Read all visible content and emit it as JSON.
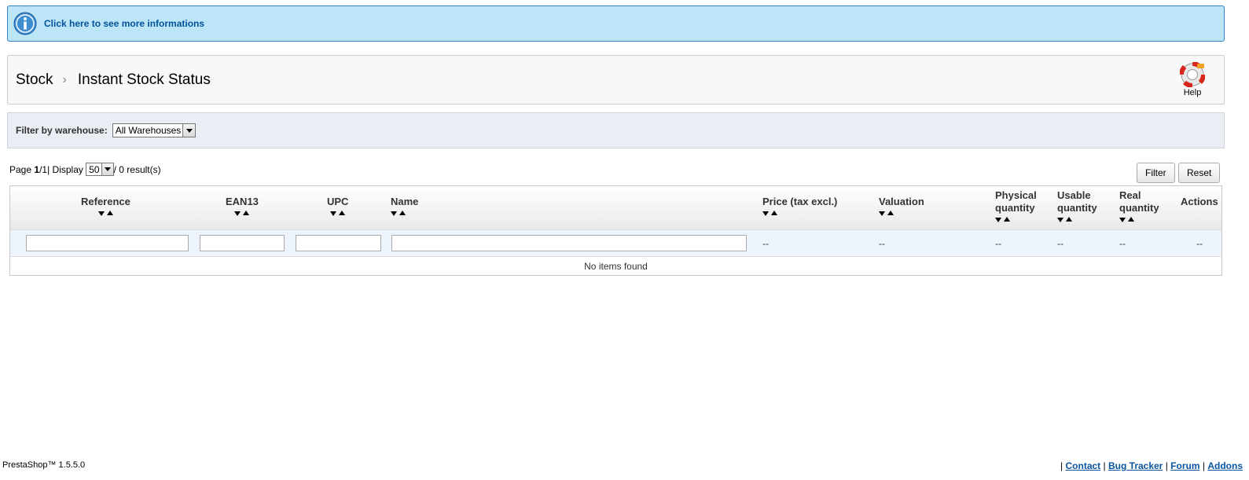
{
  "info_bar": {
    "link": "Click here to see more informations"
  },
  "toolbar": {
    "breadcrumb": {
      "parent": "Stock",
      "current": "Instant Stock Status"
    },
    "help_label": "Help"
  },
  "warehouse_filter": {
    "label": "Filter by warehouse:",
    "selected": "All Warehouses"
  },
  "pagination": {
    "page_word": "Page",
    "page": "1",
    "separator": " / ",
    "total_pages": "1",
    "display_word": " | Display",
    "per_page": "50",
    "results": " / 0 result(s)"
  },
  "buttons": {
    "filter": "Filter",
    "reset": "Reset"
  },
  "table": {
    "columns": [
      {
        "label_1": "Reference",
        "label_2": ""
      },
      {
        "label_1": "EAN13",
        "label_2": ""
      },
      {
        "label_1": "UPC",
        "label_2": ""
      },
      {
        "label_1": "Name",
        "label_2": ""
      },
      {
        "label_1": "Price (tax excl.)",
        "label_2": ""
      },
      {
        "label_1": "Valuation",
        "label_2": ""
      },
      {
        "label_1": "Physical",
        "label_2": "quantity"
      },
      {
        "label_1": "Usable",
        "label_2": "quantity"
      },
      {
        "label_1": "Real",
        "label_2": "quantity"
      },
      {
        "label_1": "Actions",
        "label_2": ""
      }
    ],
    "filter_placeholder": "--",
    "empty_message": "No items found"
  },
  "footer": {
    "version": "PrestaShop™ 1.5.5.0",
    "links": {
      "sep": "|",
      "contact": "Contact",
      "bug_tracker": "Bug Tracker",
      "forum": "Forum",
      "addons": "Addons"
    }
  },
  "colors": {
    "info_bg": "#bde5f8",
    "info_border": "#2c82c7",
    "link_blue": "#00529b",
    "filter_bg": "#ebedf4"
  },
  "icons": {
    "info": "info-circle-icon",
    "help": "lifebuoy-icon"
  }
}
